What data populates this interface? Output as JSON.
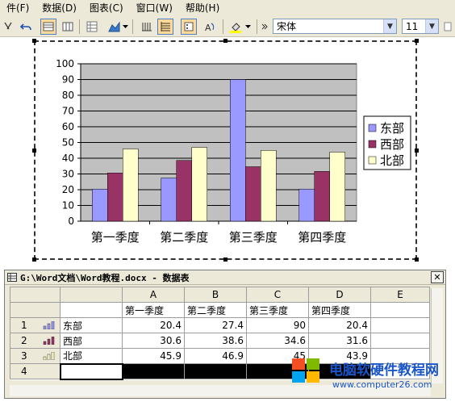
{
  "menu": [
    {
      "label": "件(F)"
    },
    {
      "label": "数据(D)"
    },
    {
      "label": "图表(C)"
    },
    {
      "label": "窗口(W)"
    },
    {
      "label": "帮助(H)"
    }
  ],
  "toolbar": {
    "font_name": "宋体",
    "font_size": "11"
  },
  "chart_data": {
    "type": "bar",
    "categories": [
      "第一季度",
      "第二季度",
      "第三季度",
      "第四季度"
    ],
    "series": [
      {
        "name": "东部",
        "color": "#9999ff",
        "values": [
          20.4,
          27.4,
          90,
          20.4
        ]
      },
      {
        "name": "西部",
        "color": "#993366",
        "values": [
          30.6,
          38.6,
          34.6,
          31.6
        ]
      },
      {
        "name": "北部",
        "color": "#ffffcc",
        "values": [
          45.9,
          46.9,
          45,
          43.9
        ]
      }
    ],
    "ylim": [
      0,
      100
    ],
    "yticks": [
      0,
      10,
      20,
      30,
      40,
      50,
      60,
      70,
      80,
      90,
      100
    ],
    "plot_background": "#c0c0c0",
    "grid": true,
    "legend": "right"
  },
  "datasheet": {
    "title": "G:\\Word文档\\Word教程.docx - 数据表",
    "columns": [
      "A",
      "B",
      "C",
      "D",
      "E"
    ],
    "quarters": [
      "第一季度",
      "第二季度",
      "第三季度",
      "第四季度"
    ],
    "rows": [
      {
        "num": "1",
        "name": "东部",
        "values": [
          "20.4",
          "27.4",
          "90",
          "20.4"
        ]
      },
      {
        "num": "2",
        "name": "西部",
        "values": [
          "30.6",
          "38.6",
          "34.6",
          "31.6"
        ]
      },
      {
        "num": "3",
        "name": "北部",
        "values": [
          "45.9",
          "46.9",
          "45",
          "43.9"
        ]
      },
      {
        "num": "4",
        "name": "",
        "values": [
          "",
          "",
          "",
          ""
        ]
      }
    ]
  },
  "watermark": {
    "site_name": "电脑软硬件教程网",
    "site_url": "www.computer26.com"
  }
}
